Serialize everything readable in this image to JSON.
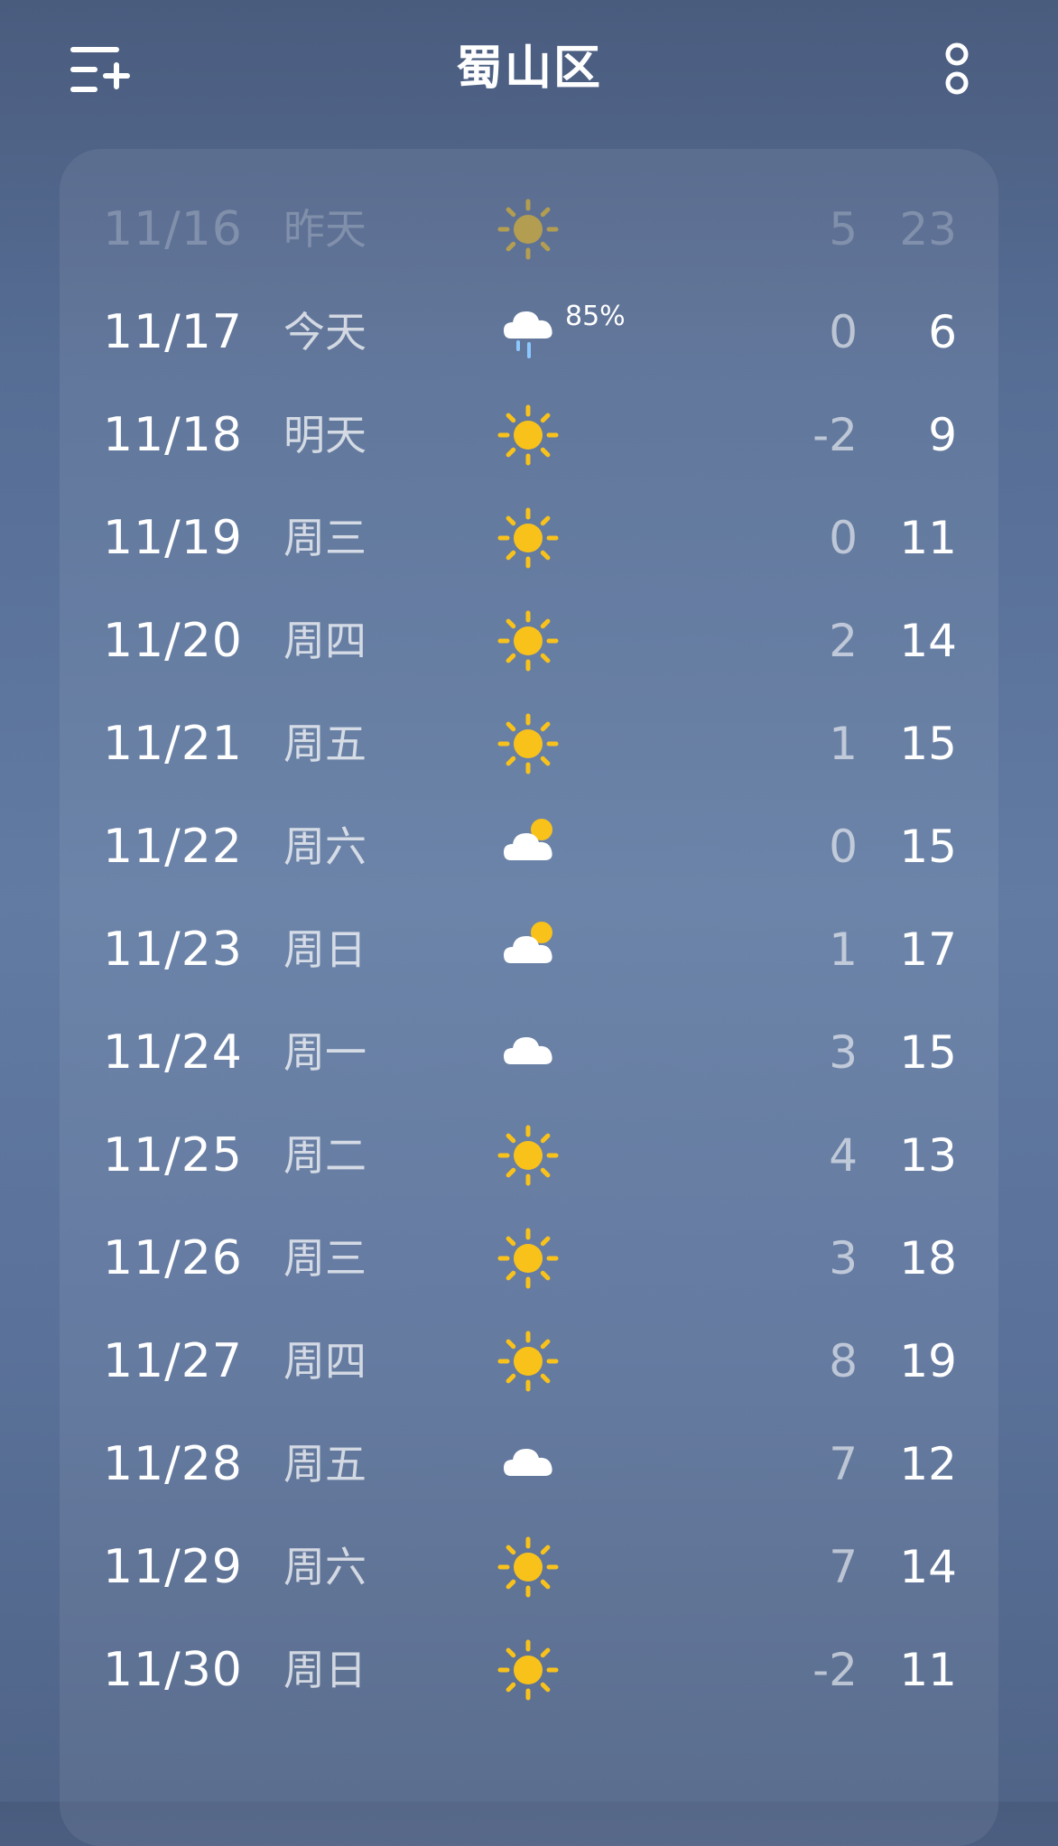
{
  "header": {
    "title": "蜀山区",
    "menu_icon": "list-add-icon",
    "more_icon": "more-options-icon"
  },
  "forecast": [
    {
      "date": "11/16",
      "day": "昨天",
      "icon": "sunny",
      "precip": "",
      "low": "5",
      "high": "23",
      "past": true
    },
    {
      "date": "11/17",
      "day": "今天",
      "icon": "rain",
      "precip": "85%",
      "low": "0",
      "high": "6",
      "past": false
    },
    {
      "date": "11/18",
      "day": "明天",
      "icon": "sunny",
      "precip": "",
      "low": "-2",
      "high": "9",
      "past": false
    },
    {
      "date": "11/19",
      "day": "周三",
      "icon": "sunny",
      "precip": "",
      "low": "0",
      "high": "11",
      "past": false
    },
    {
      "date": "11/20",
      "day": "周四",
      "icon": "sunny",
      "precip": "",
      "low": "2",
      "high": "14",
      "past": false
    },
    {
      "date": "11/21",
      "day": "周五",
      "icon": "sunny",
      "precip": "",
      "low": "1",
      "high": "15",
      "past": false
    },
    {
      "date": "11/22",
      "day": "周六",
      "icon": "partly-cloudy",
      "precip": "",
      "low": "0",
      "high": "15",
      "past": false
    },
    {
      "date": "11/23",
      "day": "周日",
      "icon": "partly-cloudy",
      "precip": "",
      "low": "1",
      "high": "17",
      "past": false
    },
    {
      "date": "11/24",
      "day": "周一",
      "icon": "cloudy",
      "precip": "",
      "low": "3",
      "high": "15",
      "past": false
    },
    {
      "date": "11/25",
      "day": "周二",
      "icon": "sunny",
      "precip": "",
      "low": "4",
      "high": "13",
      "past": false
    },
    {
      "date": "11/26",
      "day": "周三",
      "icon": "sunny",
      "precip": "",
      "low": "3",
      "high": "18",
      "past": false
    },
    {
      "date": "11/27",
      "day": "周四",
      "icon": "sunny",
      "precip": "",
      "low": "8",
      "high": "19",
      "past": false
    },
    {
      "date": "11/28",
      "day": "周五",
      "icon": "cloudy",
      "precip": "",
      "low": "7",
      "high": "12",
      "past": false
    },
    {
      "date": "11/29",
      "day": "周六",
      "icon": "sunny",
      "precip": "",
      "low": "7",
      "high": "14",
      "past": false
    },
    {
      "date": "11/30",
      "day": "周日",
      "icon": "sunny",
      "precip": "",
      "low": "-2",
      "high": "11",
      "past": false
    }
  ],
  "colors": {
    "sun": "#f9c21b",
    "cloud": "#ffffff",
    "rain": "#8cc8ff"
  }
}
